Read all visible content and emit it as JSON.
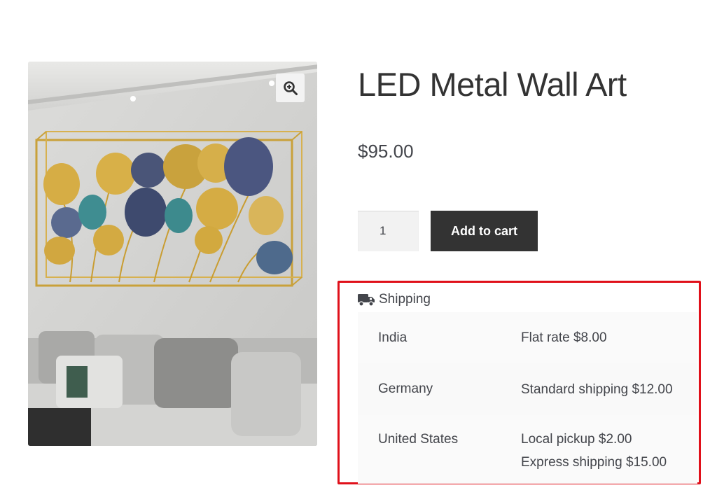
{
  "product": {
    "title": "LED Metal Wall Art",
    "price": "$95.00",
    "quantity": "1",
    "add_to_cart_label": "Add to cart",
    "image_alt": "LED Metal Wall Art"
  },
  "shipping": {
    "heading": "Shipping",
    "rows": [
      {
        "country": "India",
        "methods": [
          "Flat rate $8.00"
        ]
      },
      {
        "country": "Germany",
        "methods": [
          "Standard shipping $12.00"
        ]
      },
      {
        "country": "United States",
        "methods": [
          "Local pickup $2.00",
          "Express shipping $15.00"
        ]
      }
    ]
  },
  "colors": {
    "button_bg": "#333333",
    "highlight_border": "#e0101a",
    "text": "#43454b"
  }
}
